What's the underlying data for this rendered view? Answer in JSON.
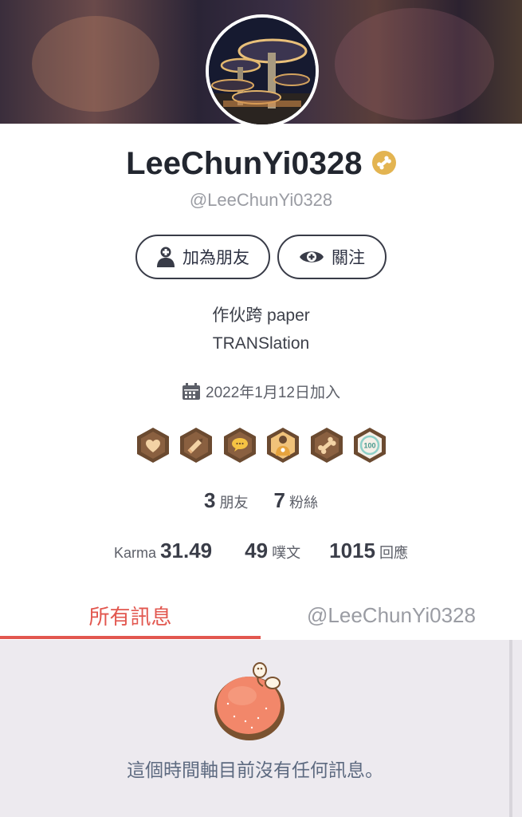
{
  "profile": {
    "display_name": "LeeChunYi0328",
    "handle": "@LeeChunYi0328",
    "bio_line1": "作伙跨 paper",
    "bio_line2": "TRANSlation",
    "joined": "2022年1月12日加入"
  },
  "actions": {
    "add_friend_label": "加為朋友",
    "follow_label": "關注"
  },
  "social": {
    "friends_count": "3",
    "friends_label": "朋友",
    "fans_count": "7",
    "fans_label": "粉絲"
  },
  "stats": {
    "karma_label": "Karma",
    "karma_value": "31.49",
    "posts_count": "49",
    "posts_label": "噗文",
    "replies_count": "1015",
    "replies_label": "回應"
  },
  "badges": [
    "heart-badge-icon",
    "pencil-badge-icon",
    "chat-badge-icon",
    "question-person-badge-icon",
    "bone-badge-icon",
    "100-badge-icon"
  ],
  "badge_100_text": "100",
  "tabs": {
    "all_label": "所有訊息",
    "handle_label": "@LeeChunYi0328"
  },
  "timeline": {
    "empty_text": "這個時間軸目前沒有任何訊息。"
  },
  "colors": {
    "accent": "#e2574f",
    "badge_brown": "#6b4a30",
    "badge_fill": "#f0c27a",
    "gold": "#e3b451"
  }
}
